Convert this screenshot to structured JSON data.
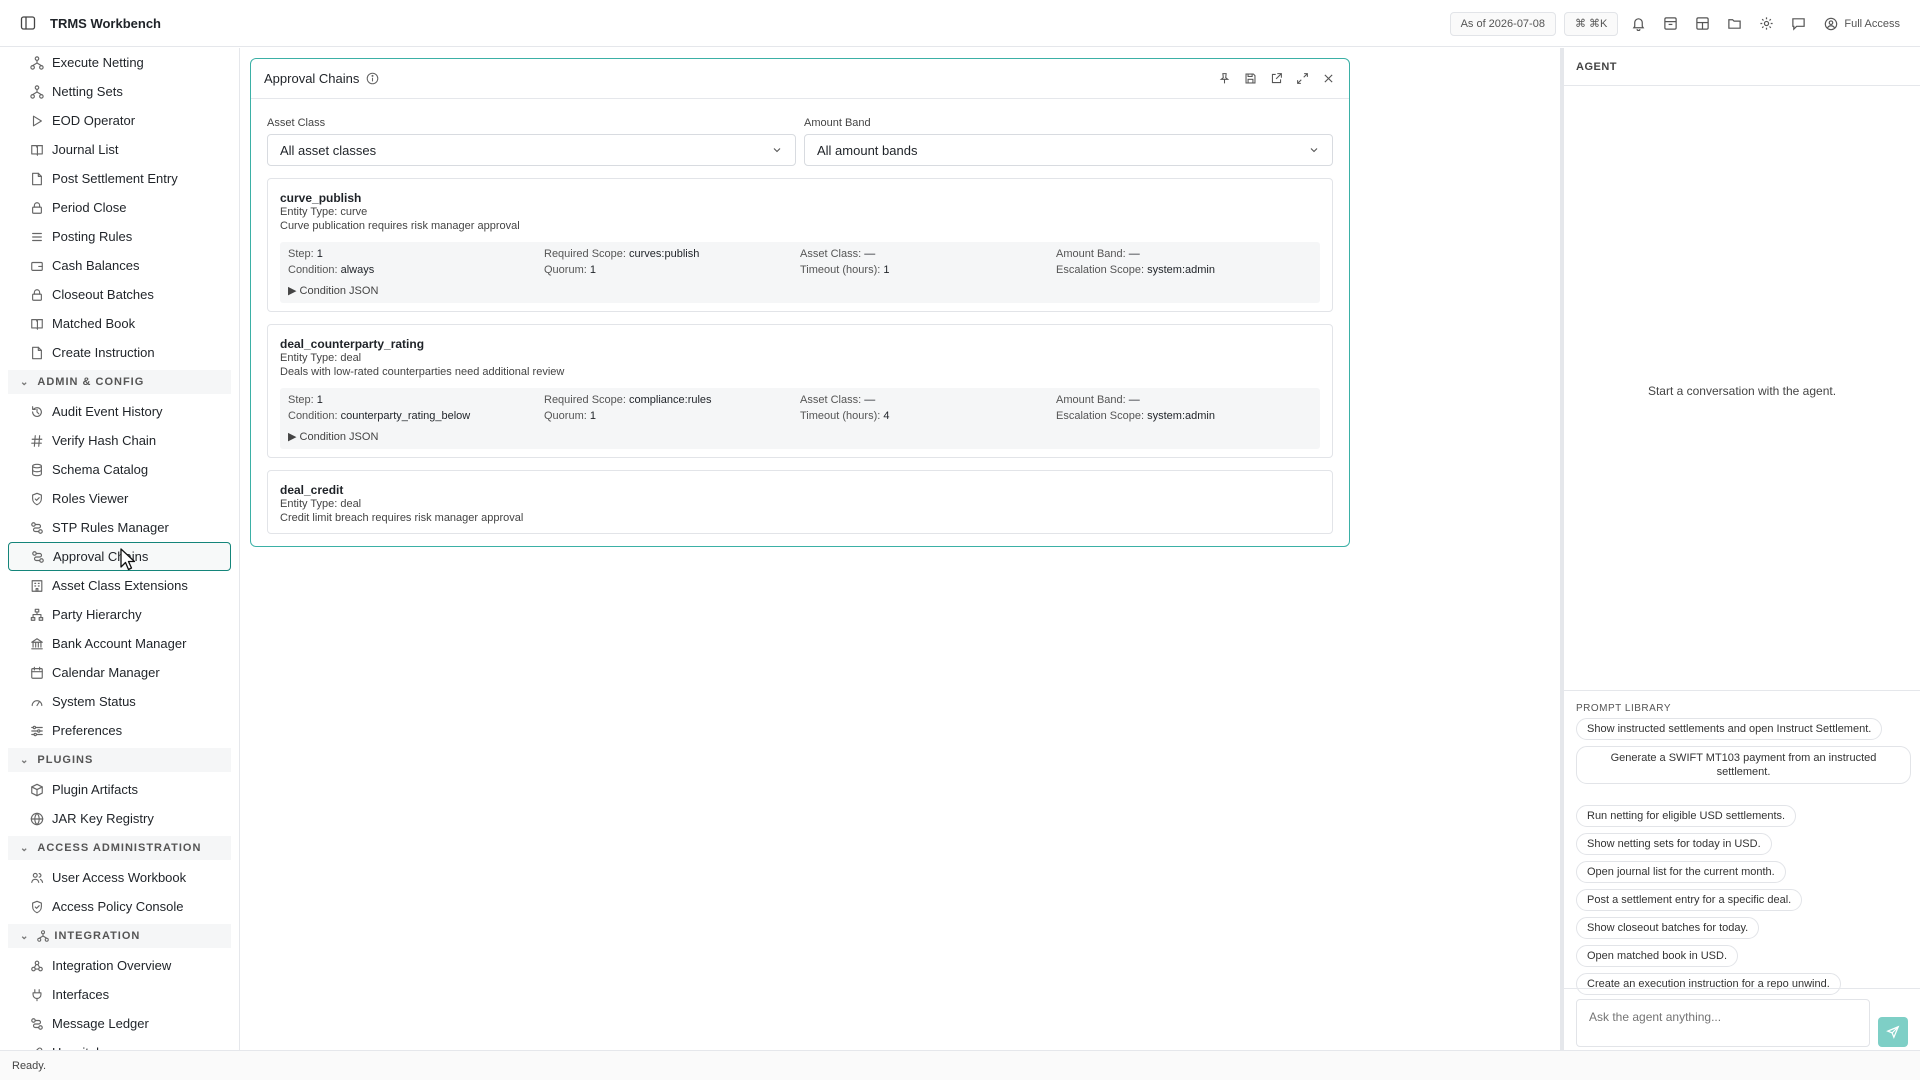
{
  "app": {
    "title": "TRMS Workbench"
  },
  "topbar": {
    "as_of": "As of 2026-07-08",
    "shortcut": "⌘ ⌘K",
    "access": "Full Access",
    "icons": [
      "bell-icon",
      "archive-icon",
      "layout-icon",
      "folder-icon",
      "gear-icon",
      "chat-icon"
    ]
  },
  "sidebar": {
    "items_top": [
      {
        "label": "Execute Netting",
        "icon": "network-icon"
      },
      {
        "label": "Netting Sets",
        "icon": "network-icon"
      },
      {
        "label": "EOD Operator",
        "icon": "play-icon"
      },
      {
        "label": "Journal List",
        "icon": "book-icon"
      },
      {
        "label": "Post Settlement Entry",
        "icon": "file-icon"
      },
      {
        "label": "Period Close",
        "icon": "lock-icon"
      },
      {
        "label": "Posting Rules",
        "icon": "list-icon"
      },
      {
        "label": "Cash Balances",
        "icon": "wallet-icon"
      },
      {
        "label": "Closeout Batches",
        "icon": "lock-icon"
      },
      {
        "label": "Matched Book",
        "icon": "book-icon"
      },
      {
        "label": "Create Instruction",
        "icon": "file-icon"
      }
    ],
    "section_admin": "ADMIN & CONFIG",
    "items_admin": [
      {
        "label": "Audit Event History",
        "icon": "history-icon"
      },
      {
        "label": "Verify Hash Chain",
        "icon": "hash-icon"
      },
      {
        "label": "Schema Catalog",
        "icon": "database-icon"
      },
      {
        "label": "Roles Viewer",
        "icon": "shield-icon"
      },
      {
        "label": "STP Rules Manager",
        "icon": "route-icon"
      },
      {
        "label": "Approval Chains",
        "icon": "route-icon"
      },
      {
        "label": "Asset Class Extensions",
        "icon": "building-icon"
      },
      {
        "label": "Party Hierarchy",
        "icon": "hierarchy-icon"
      },
      {
        "label": "Bank Account Manager",
        "icon": "bank-icon"
      },
      {
        "label": "Calendar Manager",
        "icon": "calendar-icon"
      },
      {
        "label": "System Status",
        "icon": "gauge-icon"
      },
      {
        "label": "Preferences",
        "icon": "sliders-icon"
      }
    ],
    "section_plugins": "PLUGINS",
    "items_plugins": [
      {
        "label": "Plugin Artifacts",
        "icon": "package-icon"
      },
      {
        "label": "JAR Key Registry",
        "icon": "globe-icon"
      }
    ],
    "section_access": "ACCESS ADMINISTRATION",
    "items_access": [
      {
        "label": "User Access Workbook",
        "icon": "users-icon"
      },
      {
        "label": "Access Policy Console",
        "icon": "shield-icon"
      }
    ],
    "section_integration": "INTEGRATION",
    "items_integration": [
      {
        "label": "Integration Overview",
        "icon": "webhook-icon"
      },
      {
        "label": "Interfaces",
        "icon": "plug-icon"
      },
      {
        "label": "Message Ledger",
        "icon": "route-icon"
      },
      {
        "label": "Hospital",
        "icon": "heal-icon"
      }
    ]
  },
  "panel": {
    "title": "Approval Chains",
    "filters": {
      "asset_class_label": "Asset Class",
      "asset_class_value": "All asset classes",
      "amount_band_label": "Amount Band",
      "amount_band_value": "All amount bands"
    },
    "labels": {
      "step": "Step:",
      "required_scope": "Required Scope:",
      "asset_class": "Asset Class:",
      "amount_band": "Amount Band:",
      "condition": "Condition:",
      "quorum": "Quorum:",
      "timeout": "Timeout (hours):",
      "escalation": "Escalation Scope:",
      "condition_json": "▶ Condition JSON"
    },
    "chains": [
      {
        "name": "curve_publish",
        "entity_type": "Entity Type: curve",
        "description": "Curve publication requires risk manager approval",
        "step": "1",
        "required_scope": "curves:publish",
        "asset_class": "—",
        "amount_band": "—",
        "condition": "always",
        "quorum": "1",
        "timeout": "1",
        "escalation": "system:admin"
      },
      {
        "name": "deal_counterparty_rating",
        "entity_type": "Entity Type: deal",
        "description": "Deals with low-rated counterparties need additional review",
        "step": "1",
        "required_scope": "compliance:rules",
        "asset_class": "—",
        "amount_band": "—",
        "condition": "counterparty_rating_below",
        "quorum": "1",
        "timeout": "4",
        "escalation": "system:admin"
      },
      {
        "name": "deal_credit",
        "entity_type": "Entity Type: deal",
        "description": "Credit limit breach requires risk manager approval"
      }
    ]
  },
  "agent": {
    "title": "AGENT",
    "empty": "Start a conversation with the agent.",
    "library_title": "PROMPT LIBRARY",
    "prompts": [
      "Show instructed settlements and open Instruct Settlement.",
      "Generate a SWIFT MT103 payment from an instructed settlement.",
      "Run netting for eligible USD settlements.",
      "Show netting sets for today in USD.",
      "Open journal list for the current month.",
      "Post a settlement entry for a specific deal.",
      "Show closeout batches for today.",
      "Open matched book in USD.",
      "Create an execution instruction for a repo unwind."
    ],
    "input_placeholder": "Ask the agent anything..."
  },
  "status": {
    "text": "Ready."
  },
  "colors": {
    "accent": "#14857a",
    "panel_border": "#3bb0a6",
    "send": "#7ecfc6"
  }
}
